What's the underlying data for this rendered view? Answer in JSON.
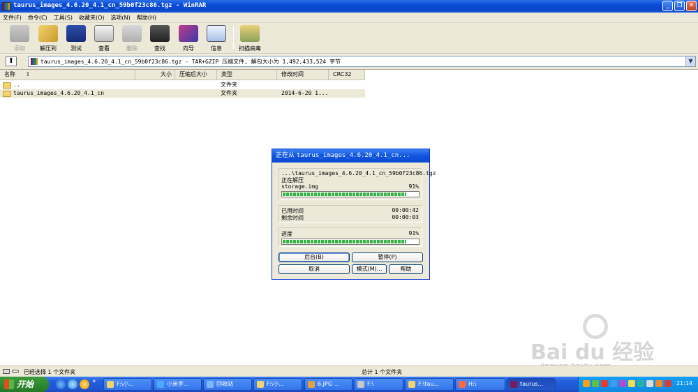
{
  "window": {
    "title": "taurus_images_4.6.20_4.1_cn_59b0f23c86.tgz - WinRAR",
    "controls": [
      "_",
      "❐",
      "✕"
    ]
  },
  "menubar": [
    "文件(F)",
    "命令(C)",
    "工具(S)",
    "收藏夹(O)",
    "选项(N)",
    "帮助(H)"
  ],
  "toolbar": [
    {
      "label": "添加",
      "icon": "add-icon",
      "disabled": true
    },
    {
      "label": "解压到",
      "icon": "extract-to-icon",
      "disabled": false
    },
    {
      "label": "测试",
      "icon": "test-icon",
      "disabled": false
    },
    {
      "label": "查看",
      "icon": "view-icon",
      "disabled": false
    },
    {
      "label": "删除",
      "icon": "delete-icon",
      "disabled": true
    },
    {
      "label": "查找",
      "icon": "find-icon",
      "disabled": false
    },
    {
      "label": "向导",
      "icon": "wizard-icon",
      "disabled": false
    },
    {
      "label": "信息",
      "icon": "info-icon",
      "disabled": false
    },
    {
      "label": "扫描病毒",
      "icon": "scan-virus-icon",
      "disabled": false
    }
  ],
  "address": {
    "path": "taurus_images_4.6.20_4.1_cn_59b0f23c86.tgz - TAR+GZIP 压缩文件, 解包大小为 1,492,433,524 字节"
  },
  "columns": [
    "名称",
    "大小",
    "压缩后大小",
    "类型",
    "修改时间",
    "CRC32"
  ],
  "rows": [
    {
      "name": "..",
      "size": "",
      "packed": "",
      "type": "文件夹",
      "modified": "",
      "crc": ""
    },
    {
      "name": "taurus_images_4.6.20_4.1_cn",
      "size": "",
      "packed": "",
      "type": "文件夹",
      "modified": "2014-6-20 1...",
      "crc": ""
    }
  ],
  "dialog": {
    "title_prefix": "正在从 ",
    "title_file": "taurus_images_4.6.20_4.1_cn...",
    "archive": "...\\taurus_images_4.6.20_4.1_cn_59b0f23c86.tgz",
    "action": "正在解压",
    "file": "storage.img",
    "file_percent": "91%",
    "file_progress": 0.91,
    "elapsed_label": "已用时间",
    "elapsed_value": "00:00:42",
    "remaining_label": "剩余时间",
    "remaining_value": "00:00:03",
    "total_label": "进度",
    "total_percent": "91%",
    "total_progress": 0.91,
    "buttons": {
      "background": "后台(B)",
      "pause": "暂停(P)",
      "cancel": "取消",
      "mode": "模式(M)...",
      "help": "帮助"
    }
  },
  "statusbar": {
    "left": "已经选择 1 个文件夹",
    "right": "总计 1 个文件夹"
  },
  "taskbar": {
    "start": "开始",
    "tasks": [
      {
        "label": "F:\\小...",
        "active": false
      },
      {
        "label": "小米手...",
        "active": false
      },
      {
        "label": "回收站",
        "active": false
      },
      {
        "label": "F:\\小...",
        "active": false
      },
      {
        "label": "6.JPG ...",
        "active": false
      },
      {
        "label": "F:\\",
        "active": false
      },
      {
        "label": "F:\\tau...",
        "active": false
      },
      {
        "label": "H:\\",
        "active": false
      },
      {
        "label": "taurus...",
        "active": true
      }
    ],
    "clock": "21:14"
  },
  "watermark": {
    "brand": "Bai du 经验",
    "url": "jingyan.baidu.com"
  }
}
